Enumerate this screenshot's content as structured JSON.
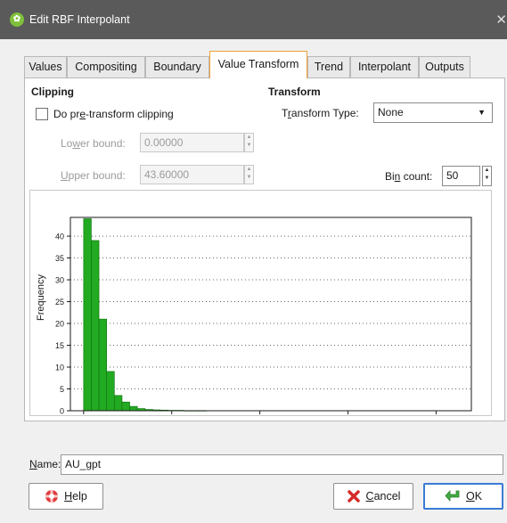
{
  "window": {
    "title": "Edit RBF Interpolant",
    "close_glyph": "✕"
  },
  "tabs": [
    {
      "label": "Values"
    },
    {
      "label": "Compositing"
    },
    {
      "label": "Boundary"
    },
    {
      "label": "Value Transform"
    },
    {
      "label": "Trend"
    },
    {
      "label": "Interpolant"
    },
    {
      "label": "Outputs"
    }
  ],
  "active_tab": "Value Transform",
  "clipping": {
    "heading": "Clipping",
    "checkbox_label_pre": "Do pr",
    "checkbox_label_u": "e",
    "checkbox_label_post": "-transform clipping",
    "checked": false,
    "lower_label_pre": "Lo",
    "lower_label_u": "w",
    "lower_label_post": "er bound:",
    "lower_value": "0.00000",
    "upper_label_pre": "",
    "upper_label_u": "U",
    "upper_label_post": "pper bound:",
    "upper_value": "43.60000"
  },
  "transform": {
    "heading": "Transform",
    "type_label_pre": "T",
    "type_label_u": "r",
    "type_label_post": "ansform Type:",
    "type_value": "None",
    "bin_label_pre": "Bi",
    "bin_label_u": "n",
    "bin_label_post": " count:",
    "bin_value": "50"
  },
  "chart_data": {
    "type": "bar",
    "ylabel": "Frequency",
    "xlabel": "",
    "xlim": [
      -1.5,
      44
    ],
    "ylim": [
      0,
      44.3
    ],
    "x_ticks": [
      0,
      10,
      20,
      30,
      40
    ],
    "y_ticks": [
      0,
      5,
      10,
      15,
      20,
      25,
      30,
      35,
      40
    ],
    "grid": "horizontal dotted",
    "bar_color": "#22aa22",
    "bin_width": 0.872,
    "bins_start": 0,
    "values": [
      44,
      39,
      21,
      9,
      3.5,
      2,
      1,
      0.5,
      0.3,
      0.2,
      0.15,
      0.1,
      0.1,
      0.05,
      0.05,
      0.05,
      0,
      0,
      0,
      0,
      0,
      0,
      0,
      0,
      0,
      0,
      0,
      0,
      0,
      0,
      0,
      0,
      0,
      0,
      0,
      0,
      0,
      0,
      0,
      0,
      0,
      0,
      0,
      0,
      0,
      0,
      0,
      0,
      0,
      0
    ]
  },
  "name": {
    "label_u": "N",
    "label_post": "ame:",
    "value": "AU_gpt"
  },
  "buttons": {
    "help_u": "H",
    "help_post": "elp",
    "cancel_u": "C",
    "cancel_post": "ancel",
    "ok_u": "O",
    "ok_post": "K"
  },
  "icons": {
    "app": "leapfrog-app-icon",
    "help": "lifebuoy-icon",
    "cancel": "red-x-icon",
    "ok": "green-arrow-icon"
  }
}
